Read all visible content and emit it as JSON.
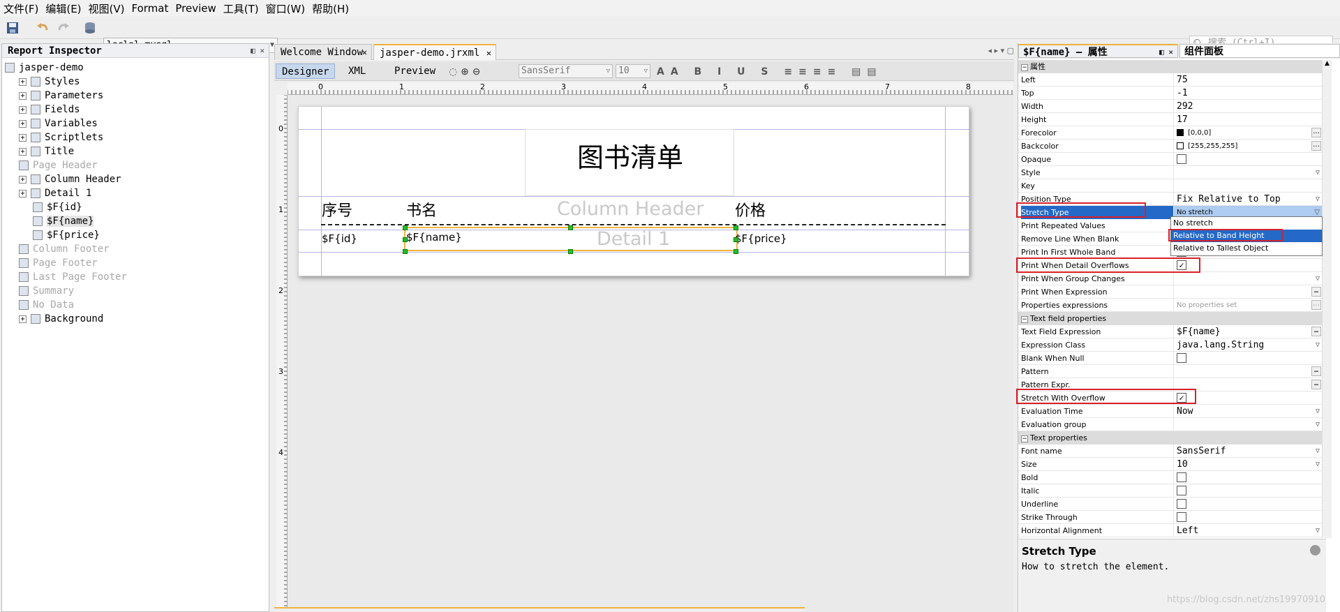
{
  "menu": [
    "文件(F)",
    "编辑(E)",
    "视图(V)",
    "Format",
    "Preview",
    "工具(T)",
    "窗口(W)",
    "帮助(H)"
  ],
  "toolbar": {
    "connection": "loclal-mysql",
    "search_placeholder": "搜索 (Ctrl+I)"
  },
  "inspector": {
    "title": "Report Inspector",
    "items": [
      {
        "label": "jasper-demo",
        "state": "normal"
      },
      {
        "label": "Styles",
        "state": "normal"
      },
      {
        "label": "Parameters",
        "state": "normal"
      },
      {
        "label": "Fields",
        "state": "normal"
      },
      {
        "label": "Variables",
        "state": "normal"
      },
      {
        "label": "Scriptlets",
        "state": "normal"
      },
      {
        "label": "Title",
        "state": "normal"
      },
      {
        "label": "Page Header",
        "state": "gray"
      },
      {
        "label": "Column Header",
        "state": "normal"
      },
      {
        "label": "Detail 1",
        "state": "normal"
      },
      {
        "label": "$F{id}",
        "state": "normal"
      },
      {
        "label": "$F{name}",
        "state": "selected"
      },
      {
        "label": "$F{price}",
        "state": "normal"
      },
      {
        "label": "Column Footer",
        "state": "gray"
      },
      {
        "label": "Page Footer",
        "state": "gray"
      },
      {
        "label": "Last Page Footer",
        "state": "gray"
      },
      {
        "label": "Summary",
        "state": "gray"
      },
      {
        "label": "No Data",
        "state": "gray"
      },
      {
        "label": "Background",
        "state": "normal"
      }
    ]
  },
  "editor": {
    "tabs": [
      "Welcome Window",
      "jasper-demo.jrxml"
    ],
    "views": [
      "Designer",
      "XML",
      "Preview"
    ],
    "font_name": "SansSerif",
    "font_size": "10",
    "ruler_labels": [
      "0",
      "1",
      "2",
      "3",
      "4",
      "5",
      "6",
      "7",
      "8"
    ],
    "vruler_labels": [
      "0",
      "1",
      "2",
      "3",
      "4"
    ],
    "report": {
      "title": "图书清单",
      "col_headers": [
        "序号",
        "书名",
        "价格"
      ],
      "band_watermarks": [
        "Column Header",
        "Detail 1"
      ],
      "detail_fields": [
        "$F{id}",
        "$F{name}",
        "$F{price}"
      ]
    }
  },
  "properties": {
    "tab_title": "$F{name} – 属性",
    "tab_palette": "组件面板",
    "section_main": "属性",
    "rows": [
      {
        "k": "Left",
        "v": "75"
      },
      {
        "k": "Top",
        "v": "-1"
      },
      {
        "k": "Width",
        "v": "292"
      },
      {
        "k": "Height",
        "v": "17"
      },
      {
        "k": "Forecolor",
        "v": "[0,0,0]"
      },
      {
        "k": "Backcolor",
        "v": "[255,255,255]"
      },
      {
        "k": "Opaque",
        "v": ""
      },
      {
        "k": "Style",
        "v": ""
      },
      {
        "k": "Key",
        "v": ""
      },
      {
        "k": "Position Type",
        "v": "Fix Relative to Top"
      },
      {
        "k": "Stretch Type",
        "v": "No stretch"
      },
      {
        "k": "Print Repeated Values",
        "v": ""
      },
      {
        "k": "Remove Line When Blank",
        "v": ""
      },
      {
        "k": "Print In First Whole Band",
        "v": ""
      },
      {
        "k": "Print When Detail Overflows",
        "v": ""
      },
      {
        "k": "Print When Group Changes",
        "v": ""
      },
      {
        "k": "Print When Expression",
        "v": ""
      },
      {
        "k": "Properties expressions",
        "v": "No properties set"
      }
    ],
    "section_text": "Text field properties",
    "text_rows": [
      {
        "k": "Text Field Expression",
        "v": "$F{name}"
      },
      {
        "k": "Expression Class",
        "v": "java.lang.String"
      },
      {
        "k": "Blank When Null",
        "v": ""
      },
      {
        "k": "Pattern",
        "v": ""
      },
      {
        "k": "Pattern Expr.",
        "v": ""
      },
      {
        "k": "Stretch With Overflow",
        "v": ""
      },
      {
        "k": "Evaluation Time",
        "v": "Now"
      },
      {
        "k": "Evaluation group",
        "v": ""
      }
    ],
    "section_font": "Text properties",
    "font_rows": [
      {
        "k": "Font name",
        "v": "SansSerif"
      },
      {
        "k": "Size",
        "v": "10"
      },
      {
        "k": "Bold",
        "v": ""
      },
      {
        "k": "Italic",
        "v": ""
      },
      {
        "k": "Underline",
        "v": ""
      },
      {
        "k": "Strike Through",
        "v": ""
      },
      {
        "k": "Horizontal Alignment",
        "v": "Left"
      }
    ],
    "dropdown_options": [
      "No stretch",
      "Relative to Band Height",
      "Relative to Tallest Object"
    ],
    "description_title": "Stretch Type",
    "description_text": "How to stretch the element."
  },
  "watermark": "https://blog.csdn.net/zhs19970910",
  "colors": {
    "accent": "#f1b23a",
    "selection": "#2469c7",
    "highlight_box": "#d6212a",
    "handle": "#22c022"
  }
}
